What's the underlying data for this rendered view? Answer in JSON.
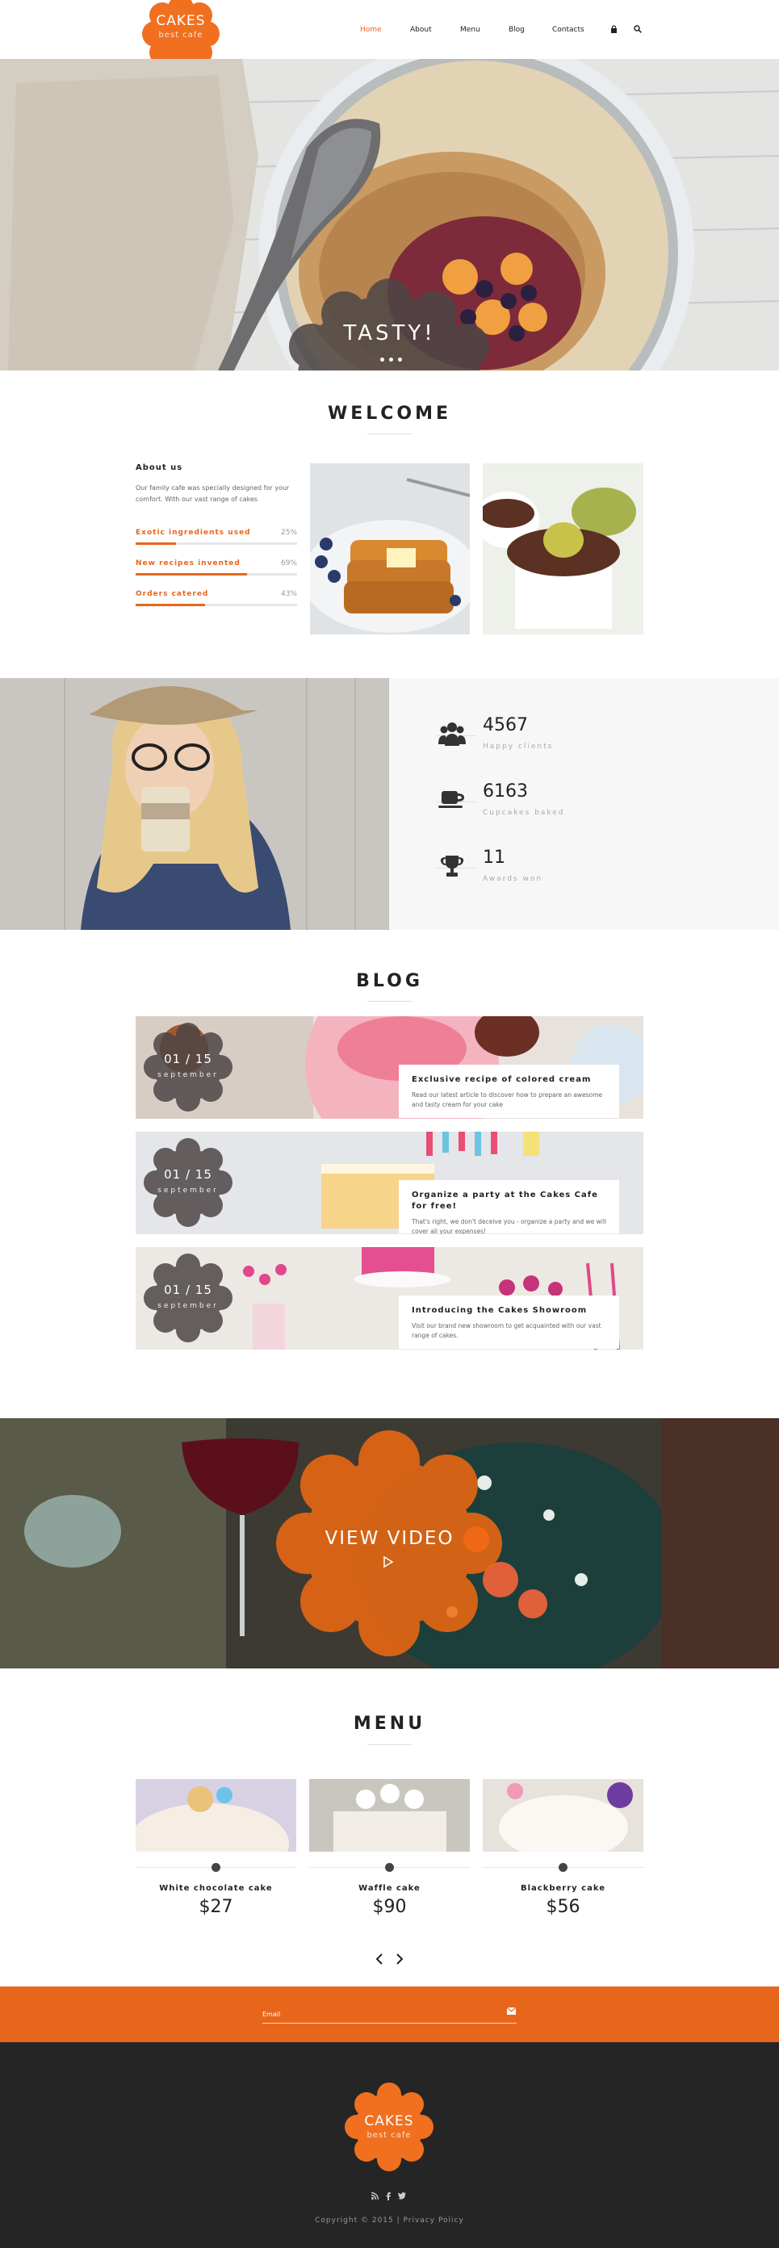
{
  "brand": {
    "name": "CAKES",
    "tagline": "best cafe",
    "accent": "#e8661c"
  },
  "nav": {
    "items": [
      "Home",
      "About",
      "Menu",
      "Blog",
      "Contacts"
    ],
    "active": "Home"
  },
  "hero": {
    "caption": "TASTY!"
  },
  "welcome": {
    "title": "WELCOME",
    "about_title": "About us",
    "about_text": "Our family cafe was specially designed for your comfort. With our vast range of cakes",
    "bars": [
      {
        "label": "Exotic ingredients used",
        "percent": 25
      },
      {
        "label": "New recipes invented",
        "percent": 69
      },
      {
        "label": "Orders catered",
        "percent": 43
      }
    ]
  },
  "stats": [
    {
      "icon": "people-icon",
      "number": "4567",
      "caption": "Happy clients"
    },
    {
      "icon": "cup-icon",
      "number": "6163",
      "caption": "Cupcakes baked"
    },
    {
      "icon": "trophy-icon",
      "number": "11",
      "caption": "Awards won"
    }
  ],
  "blog": {
    "title": "BLOG",
    "posts": [
      {
        "date": "01 / 15",
        "month": "september",
        "title": "Exclusive recipe of colored cream",
        "text": "Read our latest article to discover how to prepare an awesome and tasty cream for your cake"
      },
      {
        "date": "01 / 15",
        "month": "september",
        "title": "Organize a party at the Cakes Cafe for free!",
        "text": "That's right, we don't deceive you - organize a party and we will cover all your expenses!"
      },
      {
        "date": "01 / 15",
        "month": "september",
        "title": "Introducing the Cakes Showroom",
        "text": "Visit our brand new showroom to get acquainted with our vast range of cakes."
      }
    ]
  },
  "video": {
    "label": "VIEW VIDEO"
  },
  "menu": {
    "title": "MENU",
    "items": [
      {
        "name": "White chocolate cake",
        "price": "$27"
      },
      {
        "name": "Waffle cake",
        "price": "$90"
      },
      {
        "name": "Blackberry cake",
        "price": "$56"
      }
    ]
  },
  "newsletter": {
    "placeholder": "Email"
  },
  "footer": {
    "copyright": "Copyright © 2015 | Privacy Policy"
  }
}
